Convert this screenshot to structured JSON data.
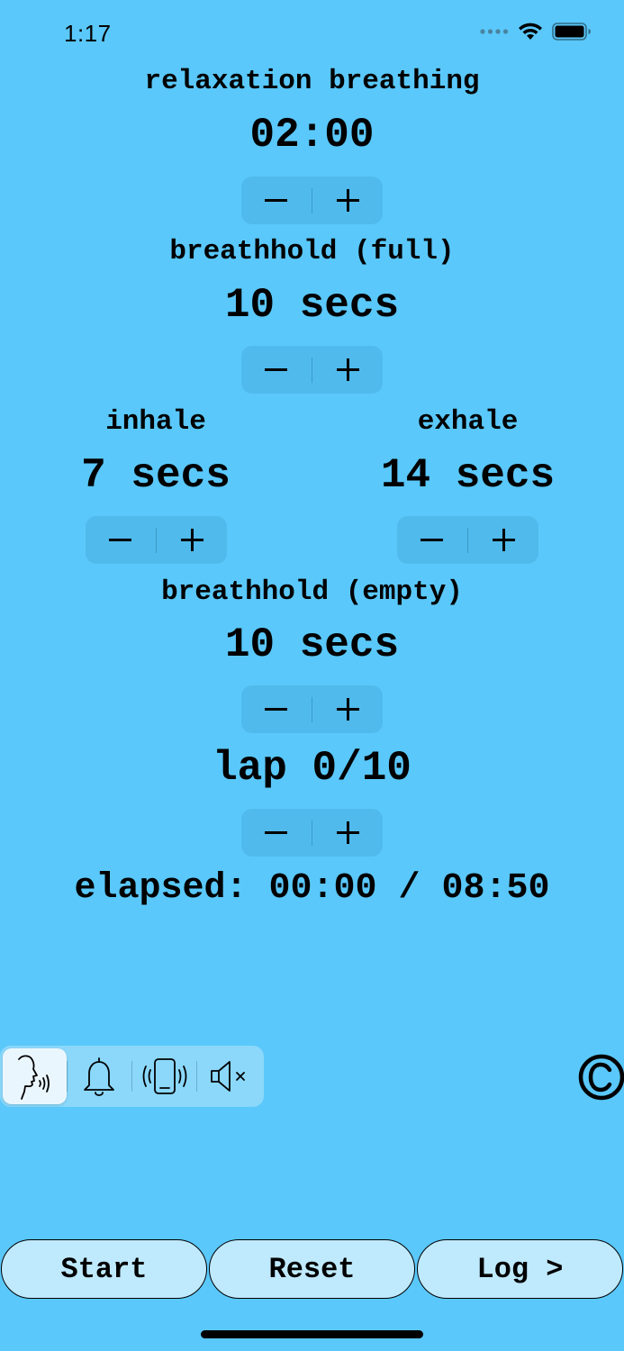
{
  "status_bar": {
    "time": "1:17",
    "icons": [
      "cellular-icon",
      "wifi-icon",
      "battery-icon"
    ]
  },
  "relaxation": {
    "label": "relaxation breathing",
    "value": "02:00"
  },
  "breathhold_full": {
    "label": "breathhold (full)",
    "value": "10 secs"
  },
  "inhale": {
    "label": "inhale",
    "value": "7 secs"
  },
  "exhale": {
    "label": "exhale",
    "value": "14 secs"
  },
  "breathhold_empty": {
    "label": "breathhold (empty)",
    "value": "10 secs"
  },
  "lap": {
    "value": "lap 0/10"
  },
  "elapsed": {
    "text": "elapsed: 00:00 / 08:50"
  },
  "mode_selector": {
    "options": [
      "voice-icon",
      "bell-icon",
      "vibrate-icon",
      "mute-icon"
    ],
    "selected": "voice-icon"
  },
  "buttons": {
    "start": "Start",
    "reset": "Reset",
    "log": "Log >"
  },
  "colors": {
    "background": "#5ac8fa",
    "button_fill": "#bfe9fd"
  }
}
